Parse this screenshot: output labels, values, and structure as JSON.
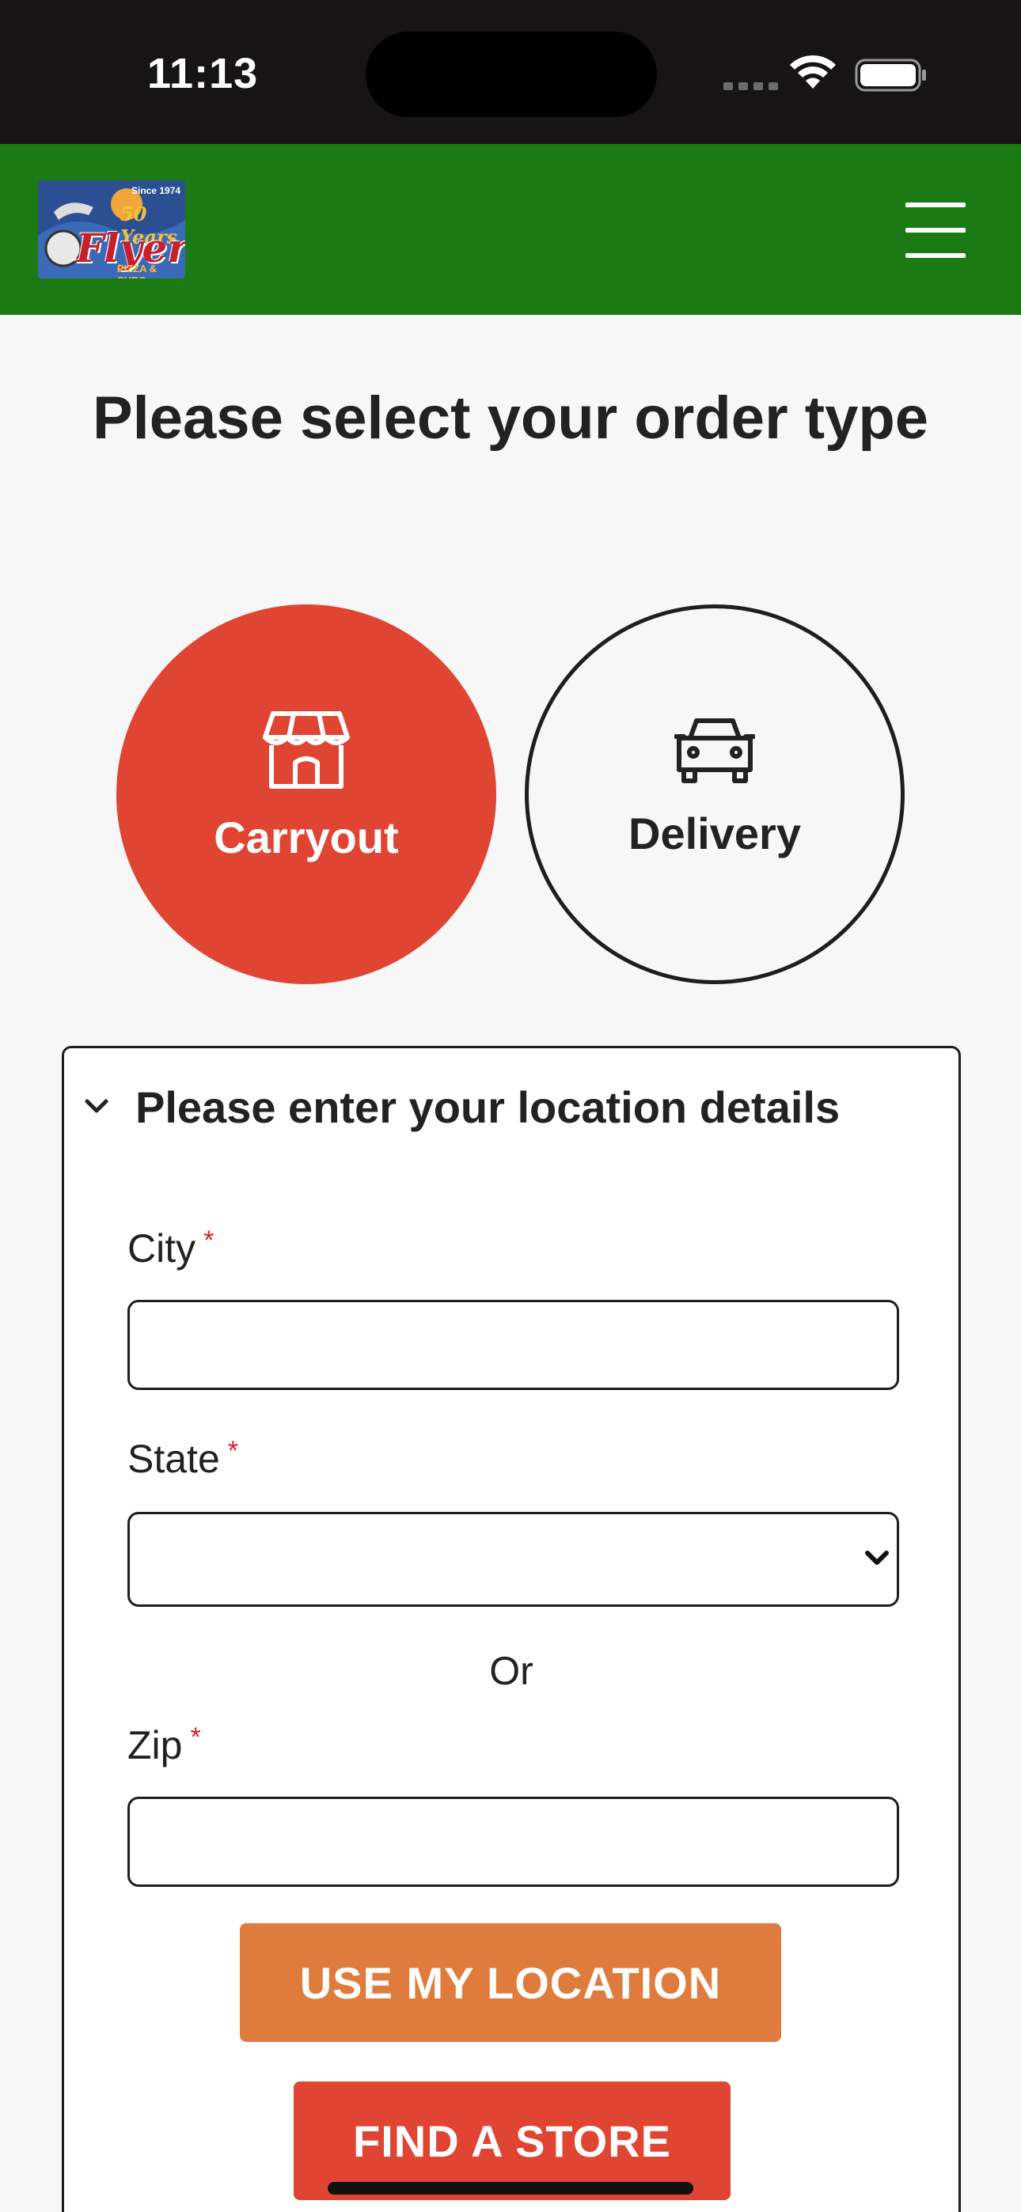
{
  "status_bar": {
    "time": "11:13"
  },
  "header": {
    "logo": {
      "since": "Since 1974",
      "years": "50 Years",
      "name": "Flyers",
      "sub": "PIZZA & SUBS"
    },
    "menu_icon": "hamburger-menu-icon"
  },
  "page": {
    "title": "Please select your order type"
  },
  "order_types": {
    "carryout": {
      "label": "Carryout",
      "icon": "storefront-icon",
      "selected": true,
      "color": "#e04433"
    },
    "delivery": {
      "label": "Delivery",
      "icon": "car-icon",
      "selected": false
    }
  },
  "location": {
    "title": "Please enter your location details",
    "city": {
      "label": "City",
      "required_mark": "*",
      "value": ""
    },
    "state": {
      "label": "State",
      "required_mark": "*",
      "value": ""
    },
    "or": "Or",
    "zip": {
      "label": "Zip",
      "required_mark": "*",
      "value": ""
    },
    "use_location_button": "USE MY LOCATION",
    "find_store_button": "FIND A STORE"
  },
  "colors": {
    "header_green": "#1b7a13",
    "accent_red": "#e04433",
    "accent_orange": "#df7c3d"
  }
}
